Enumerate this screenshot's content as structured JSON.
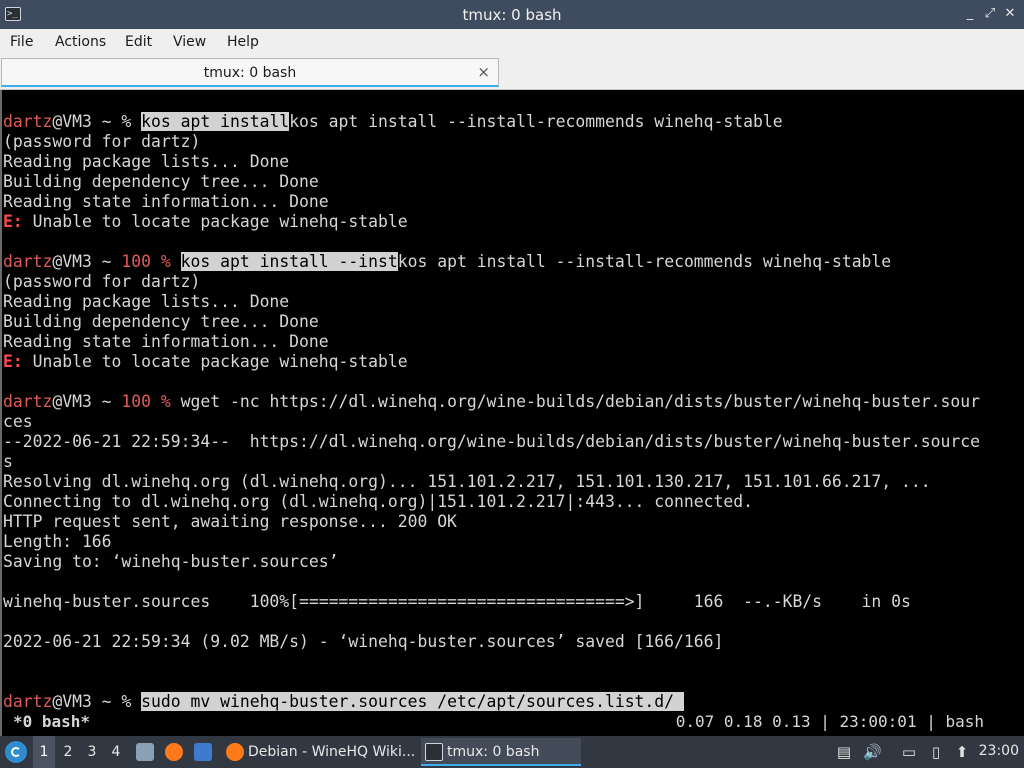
{
  "window": {
    "title": "tmux: 0 bash",
    "controls": {
      "minimize": "_",
      "maximize": "⤢",
      "close": "✕"
    }
  },
  "menubar": {
    "items": [
      "File",
      "Actions",
      "Edit",
      "View",
      "Help"
    ]
  },
  "tabs": [
    {
      "label": "tmux: 0 bash",
      "close": "×"
    }
  ],
  "terminal": {
    "lines": [
      {
        "segments": [
          {
            "t": "dartz",
            "c": "u"
          },
          {
            "t": "@VM3 ~ % "
          },
          {
            "t": "kos apt install",
            "c": "sel"
          },
          {
            "t": "kos apt install --install-recommends winehq-stable"
          }
        ]
      },
      {
        "segments": [
          {
            "t": "(password for dartz)"
          }
        ]
      },
      {
        "segments": [
          {
            "t": "Reading package lists... Done"
          }
        ]
      },
      {
        "segments": [
          {
            "t": "Building dependency tree... Done"
          }
        ]
      },
      {
        "segments": [
          {
            "t": "Reading state information... Done"
          }
        ]
      },
      {
        "segments": [
          {
            "t": "E:",
            "c": "e"
          },
          {
            "t": " Unable to locate package winehq-stable"
          }
        ]
      },
      {
        "segments": [
          {
            "t": ""
          }
        ]
      },
      {
        "segments": [
          {
            "t": "dartz",
            "c": "u"
          },
          {
            "t": "@VM3 ~ "
          },
          {
            "t": "100",
            "c": "code"
          },
          {
            "t": " "
          },
          {
            "t": "%",
            "c": "code"
          },
          {
            "t": " "
          },
          {
            "t": "kos apt install --inst",
            "c": "sel"
          },
          {
            "t": "kos apt install --install-recommends winehq-stable"
          }
        ]
      },
      {
        "segments": [
          {
            "t": "(password for dartz)"
          }
        ]
      },
      {
        "segments": [
          {
            "t": "Reading package lists... Done"
          }
        ]
      },
      {
        "segments": [
          {
            "t": "Building dependency tree... Done"
          }
        ]
      },
      {
        "segments": [
          {
            "t": "Reading state information... Done"
          }
        ]
      },
      {
        "segments": [
          {
            "t": "E:",
            "c": "e"
          },
          {
            "t": " Unable to locate package winehq-stable"
          }
        ]
      },
      {
        "segments": [
          {
            "t": ""
          }
        ]
      },
      {
        "segments": [
          {
            "t": "dartz",
            "c": "u"
          },
          {
            "t": "@VM3 ~ "
          },
          {
            "t": "100",
            "c": "code"
          },
          {
            "t": " "
          },
          {
            "t": "%",
            "c": "code"
          },
          {
            "t": " wget -nc https://dl.winehq.org/wine-builds/debian/dists/buster/winehq-buster.sour"
          }
        ]
      },
      {
        "segments": [
          {
            "t": "ces"
          }
        ]
      },
      {
        "segments": [
          {
            "t": "--2022-06-21 22:59:34--  https://dl.winehq.org/wine-builds/debian/dists/buster/winehq-buster.source"
          }
        ]
      },
      {
        "segments": [
          {
            "t": "s"
          }
        ]
      },
      {
        "segments": [
          {
            "t": "Resolving dl.winehq.org (dl.winehq.org)... 151.101.2.217, 151.101.130.217, 151.101.66.217, ..."
          }
        ]
      },
      {
        "segments": [
          {
            "t": "Connecting to dl.winehq.org (dl.winehq.org)|151.101.2.217|:443... connected."
          }
        ]
      },
      {
        "segments": [
          {
            "t": "HTTP request sent, awaiting response... 200 OK"
          }
        ]
      },
      {
        "segments": [
          {
            "t": "Length: 166"
          }
        ]
      },
      {
        "segments": [
          {
            "t": "Saving to: ‘winehq-buster.sources’"
          }
        ]
      },
      {
        "segments": [
          {
            "t": ""
          }
        ]
      },
      {
        "segments": [
          {
            "t": "winehq-buster.sources    100%[=================================>]     166  --.-KB/s    in 0s"
          }
        ]
      },
      {
        "segments": [
          {
            "t": ""
          }
        ]
      },
      {
        "segments": [
          {
            "t": "2022-06-21 22:59:34 (9.02 MB/s) - ‘winehq-buster.sources’ saved [166/166]"
          }
        ]
      },
      {
        "segments": [
          {
            "t": ""
          }
        ]
      },
      {
        "segments": [
          {
            "t": ""
          }
        ]
      },
      {
        "segments": [
          {
            "t": "dartz",
            "c": "u"
          },
          {
            "t": "@VM3 ~ % "
          },
          {
            "t": "sudo mv winehq-buster.sources /etc/apt/sources.list.d/ ",
            "c": "sel"
          }
        ]
      }
    ],
    "status": {
      "left": "*0 bash*",
      "right": "0.07 0.18 0.13 | 23:00:01 | bash"
    }
  },
  "taskbar": {
    "workspaces": [
      "1",
      "2",
      "3",
      "4"
    ],
    "active_workspace": "1",
    "launchers": [
      {
        "name": "file-manager-icon",
        "color": "#8aa0b4"
      },
      {
        "name": "firefox-icon",
        "color": "#ff7a1a"
      },
      {
        "name": "show-desktop-icon",
        "color": "#3d7ccc"
      }
    ],
    "tasks": [
      {
        "label": "Debian - WineHQ Wiki...",
        "icon": "firefox-icon",
        "active": false
      },
      {
        "label": "tmux: 0 bash",
        "icon": "terminal-icon",
        "active": true
      }
    ],
    "tray": [
      {
        "name": "clipboard-icon",
        "glyph": "▤"
      },
      {
        "name": "volume-icon",
        "glyph": "🔊"
      },
      {
        "name": "network-icon",
        "glyph": "▭"
      },
      {
        "name": "notes-icon",
        "glyph": "▯"
      },
      {
        "name": "update-icon",
        "glyph": "⬆"
      }
    ],
    "clock": "23:00"
  }
}
